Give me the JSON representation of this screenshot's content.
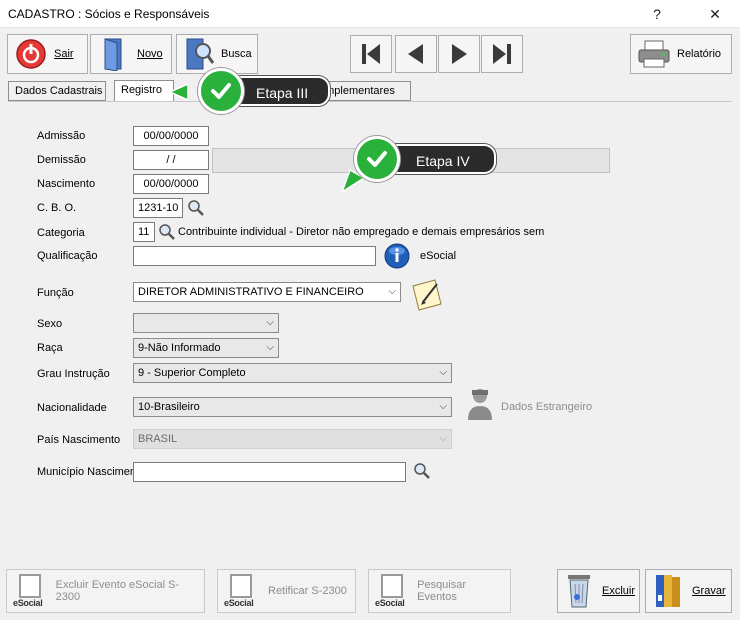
{
  "window": {
    "title": "CADASTRO : Sócios e Responsáveis",
    "help_label": "?",
    "close_label": "✕"
  },
  "toolbar": {
    "sair_label": "Sair",
    "novo_label": "Novo",
    "busca_label": "Busca",
    "relatorio_label": "Relatório"
  },
  "tabs": [
    {
      "label": "Dados Cadastrais"
    },
    {
      "label": "Registro"
    },
    {
      "label": "omplementares"
    }
  ],
  "callouts": {
    "etapa3": "Etapa III",
    "etapa4": "Etapa IV"
  },
  "form": {
    "admissao": {
      "label": "Admissão",
      "value": "00/00/0000"
    },
    "demissao": {
      "label": "Demissão",
      "value": " /  /"
    },
    "nascimento": {
      "label": "Nascimento",
      "value": "00/00/0000"
    },
    "cbo": {
      "label": "C. B. O.",
      "value": "1231-10"
    },
    "categoria": {
      "label": "Categoria",
      "value": "11",
      "description": "Contribuinte individual - Diretor não empregado e demais empresários sem"
    },
    "qualificacao": {
      "label": "Qualificação",
      "value": "",
      "esocial_label": "eSocial"
    },
    "funcao": {
      "label": "Função",
      "value": "DIRETOR ADMINISTRATIVO E FINANCEIRO"
    },
    "sexo": {
      "label": "Sexo",
      "value": ""
    },
    "raca": {
      "label": "Raça",
      "value": "9-Não Informado"
    },
    "grau_instrucao": {
      "label": "Grau Instrução",
      "value": "9  - Superior Completo"
    },
    "nacionalidade": {
      "label": "Nacionalidade",
      "value": "10-Brasileiro",
      "estrangeiro_label": "Dados Estrangeiro"
    },
    "pais_nascimento": {
      "label": "País Nascimento",
      "value": "BRASIL"
    },
    "municipio_nascimento": {
      "label": "Município Nascimen",
      "value": ""
    }
  },
  "bottom": {
    "excluir_evento_label": "Excluir Evento eSocial S-2300",
    "retificar_label": "Retificar S-2300",
    "pesquisar_label": "Pesquisar Eventos",
    "excluir_label": "Excluir",
    "gravar_label": "Gravar",
    "esocial_icon_text": "eSocial"
  }
}
